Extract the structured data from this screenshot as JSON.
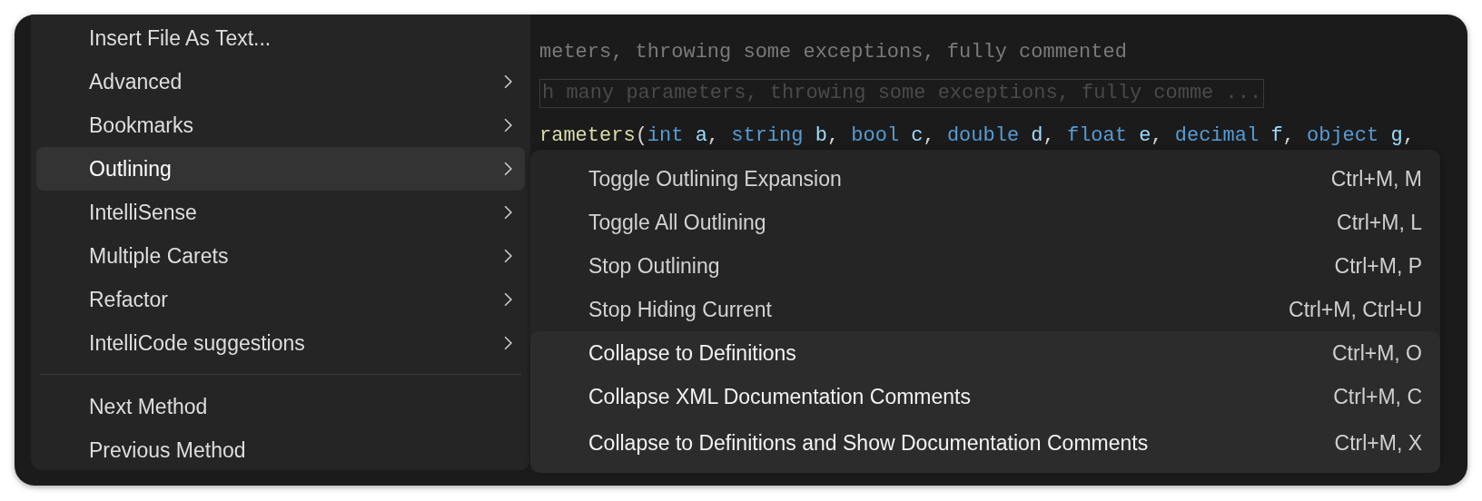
{
  "editor": {
    "lines": [
      {
        "kind": "comment",
        "text": "meters, throwing some exceptions, fully commented"
      },
      {
        "kind": "collapsed",
        "text": "h many parameters, throwing some exceptions, fully comme ..."
      },
      {
        "kind": "code",
        "tokens": [
          {
            "kind": "method",
            "text": "rameters"
          },
          {
            "kind": "punct",
            "text": "("
          },
          {
            "kind": "keyword",
            "text": "int"
          },
          {
            "kind": "param",
            "text": " a"
          },
          {
            "kind": "punct",
            "text": ", "
          },
          {
            "kind": "keyword",
            "text": "string"
          },
          {
            "kind": "param",
            "text": " b"
          },
          {
            "kind": "punct",
            "text": ", "
          },
          {
            "kind": "keyword",
            "text": "bool"
          },
          {
            "kind": "param",
            "text": " c"
          },
          {
            "kind": "punct",
            "text": ", "
          },
          {
            "kind": "keyword",
            "text": "double"
          },
          {
            "kind": "param",
            "text": " d"
          },
          {
            "kind": "punct",
            "text": ", "
          },
          {
            "kind": "keyword",
            "text": "float"
          },
          {
            "kind": "param",
            "text": " e"
          },
          {
            "kind": "punct",
            "text": ", "
          },
          {
            "kind": "keyword",
            "text": "decimal"
          },
          {
            "kind": "param",
            "text": " f"
          },
          {
            "kind": "punct",
            "text": ", "
          },
          {
            "kind": "keyword",
            "text": "object"
          },
          {
            "kind": "param",
            "text": " g"
          },
          {
            "kind": "punct",
            "text": ","
          }
        ]
      }
    ]
  },
  "context_menu": {
    "items": [
      {
        "kind": "item",
        "label": "Insert File As Text...",
        "has_submenu": false,
        "selected": false
      },
      {
        "kind": "item",
        "label": "Advanced",
        "has_submenu": true,
        "selected": false
      },
      {
        "kind": "item",
        "label": "Bookmarks",
        "has_submenu": true,
        "selected": false
      },
      {
        "kind": "item",
        "label": "Outlining",
        "has_submenu": true,
        "selected": true
      },
      {
        "kind": "item",
        "label": "IntelliSense",
        "has_submenu": true,
        "selected": false
      },
      {
        "kind": "item",
        "label": "Multiple Carets",
        "has_submenu": true,
        "selected": false
      },
      {
        "kind": "item",
        "label": "Refactor",
        "has_submenu": true,
        "selected": false
      },
      {
        "kind": "item",
        "label": "IntelliCode suggestions",
        "has_submenu": true,
        "selected": false
      },
      {
        "kind": "separator"
      },
      {
        "kind": "item",
        "label": "Next Method",
        "has_submenu": false,
        "selected": false
      },
      {
        "kind": "item",
        "label": "Previous Method",
        "has_submenu": false,
        "selected": false
      }
    ]
  },
  "submenu": {
    "items": [
      {
        "label": "Toggle Outlining Expansion",
        "shortcut": "Ctrl+M, M",
        "selected": false
      },
      {
        "label": "Toggle All Outlining",
        "shortcut": "Ctrl+M, L",
        "selected": false
      },
      {
        "label": "Stop Outlining",
        "shortcut": "Ctrl+M, P",
        "selected": false
      },
      {
        "label": "Stop Hiding Current",
        "shortcut": "Ctrl+M, Ctrl+U",
        "selected": false
      },
      {
        "label": "Collapse to Definitions",
        "shortcut": "Ctrl+M, O",
        "selected": true
      },
      {
        "label": "Collapse XML Documentation Comments",
        "shortcut": "Ctrl+M, C",
        "selected": true
      },
      {
        "label": "Collapse to Definitions and Show Documentation Comments",
        "shortcut": "Ctrl+M, X",
        "selected": true
      }
    ]
  }
}
